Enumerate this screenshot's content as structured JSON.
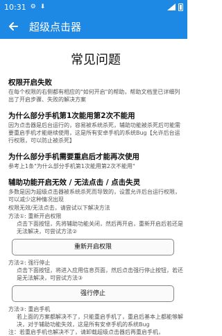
{
  "status_bar": {
    "time": "10:31"
  },
  "app_bar": {
    "title": "超级点击器"
  },
  "page_title": "常见问题",
  "faq1": {
    "q": "权限开启失败",
    "a": "在每个权限的右侧都有相应的\"如何开启\"的帮助，帮助文档里已详细列出了开启步骤、失败的解决方案"
  },
  "faq2": {
    "q": "为什么部分手机第1次能用第2次不能用",
    "a": "因为点击器是后台运行的，容易被系统杀死，辅助功能被杀死后可能需要重启手机才能继续使用，这是所有安卓手机的系统Bug【允许后台运行权限，可以防止被杀死】"
  },
  "faq3": {
    "q": "为什么部分手机需要重启后才能再次使用",
    "a": "参考上1条\"为什么部分手机第1次能用第2次不能用\""
  },
  "faq4": {
    "q": "辅助功能开启无效 / 无法点击 / 点击失灵",
    "a": "多数是因为超级点击器被系统杀死而导致的，设置允许后台运行权限，可以减少这种情况出现",
    "intro": "权限无效/无法点击，请尝试以下解决方法",
    "m1_title": "方法①: 重新开启权限",
    "m1_desc": "点击下面按钮，先将辅助功能关闭，然后再开启，重新开启后若还是无法解决，可尝试方法②",
    "m1_button": "重新开启权限",
    "m2_title": "方法②: 强行停止",
    "m2_desc": "点击下面按钮，将进入应用信息页面，然后点击强行停止按钮，若还是无法解决，可尝试方法③",
    "m2_button": "强行停止",
    "m3_title": "方法③: 重启手机",
    "m3_desc": "若上面的方案都解决不了，只能重启手机了，重启后基本上都能够解决，对于辅助功能失效，这是所有安卓手机的系统Bug",
    "note": "注：若重启手机也解决不了，请卸载超级点击器后再重启手机，"
  }
}
